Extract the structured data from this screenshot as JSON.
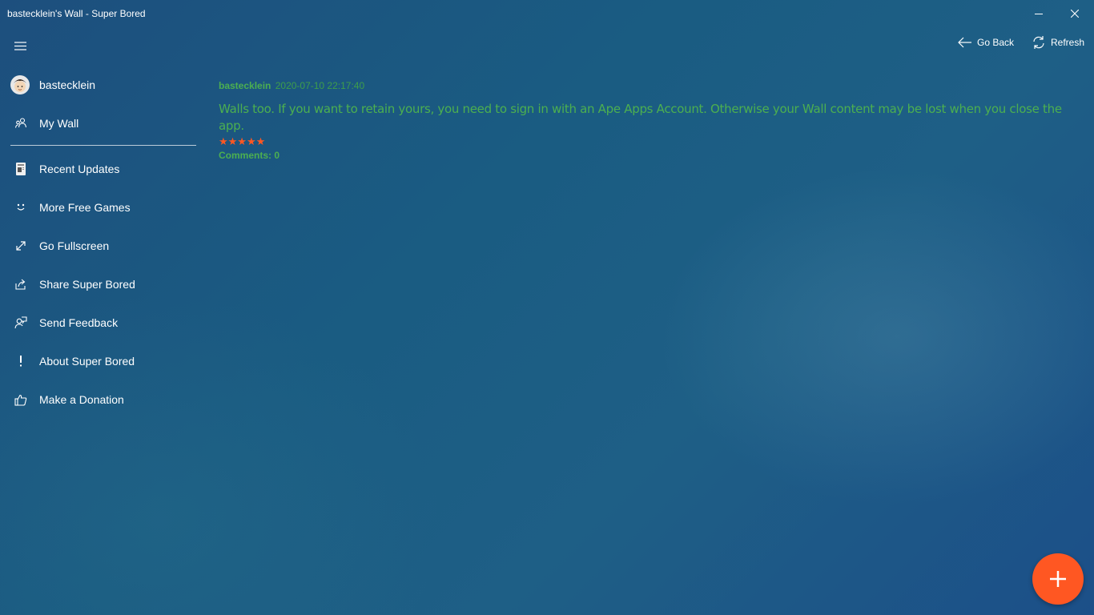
{
  "window": {
    "title": "bastecklein's Wall - Super Bored"
  },
  "toolbar": {
    "go_back_label": "Go Back",
    "refresh_label": "Refresh"
  },
  "sidebar": {
    "user": {
      "name": "bastecklein",
      "icon": "avatar"
    },
    "items": [
      {
        "label": "My Wall",
        "icon": "people-icon"
      },
      {
        "label": "Recent Updates",
        "icon": "news-icon"
      },
      {
        "label": "More Free Games",
        "icon": "smile-icon"
      },
      {
        "label": "Go Fullscreen",
        "icon": "fullscreen-icon"
      },
      {
        "label": "Share Super Bored",
        "icon": "share-icon"
      },
      {
        "label": "Send Feedback",
        "icon": "feedback-icon"
      },
      {
        "label": "About Super Bored",
        "icon": "info-icon"
      },
      {
        "label": "Make a Donation",
        "icon": "thumbs-up-icon"
      }
    ]
  },
  "post": {
    "author": "bastecklein",
    "date": "2020-07-10 22:17:40",
    "body": "Walls too. If you want to retain yours, you need to sign in with an Ape Apps Account. Otherwise your Wall content may be lost when you close the app.",
    "stars": "★★★★★",
    "rating": 5,
    "comments": "Comments: 0"
  },
  "colors": {
    "accent": "#ff5722",
    "post_text": "#4caf50",
    "background": "#1d5a82"
  }
}
